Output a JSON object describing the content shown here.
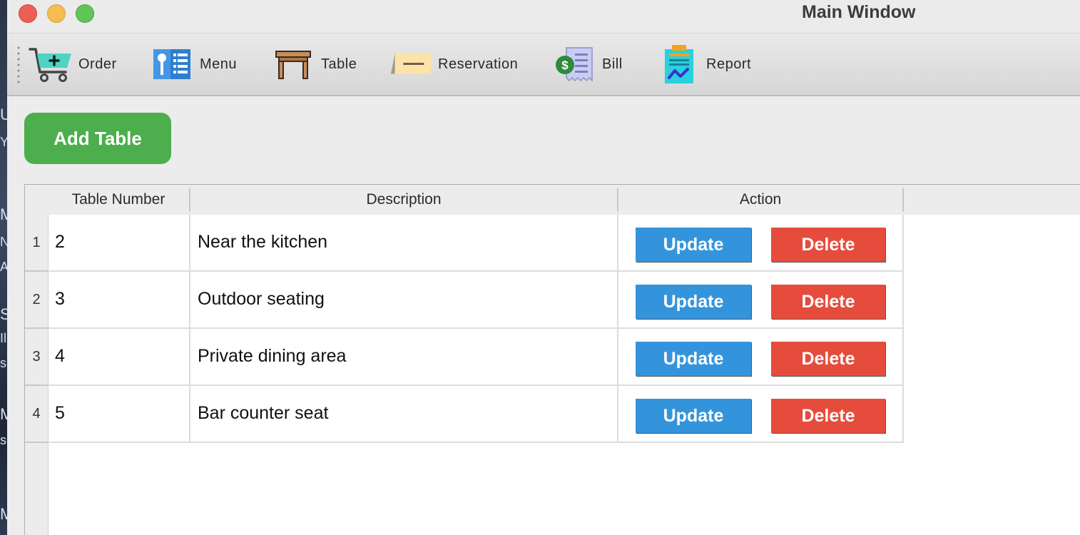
{
  "window": {
    "title": "Main Window"
  },
  "desktop_glimpse": [
    "U",
    "Y",
    "M",
    "N",
    "A",
    "S",
    "Il",
    "s",
    "M",
    "s",
    "M"
  ],
  "toolbar": {
    "items": [
      {
        "label": "Order",
        "icon": "shopping-cart-icon"
      },
      {
        "label": "Menu",
        "icon": "menu-list-icon"
      },
      {
        "label": "Table",
        "icon": "table-icon"
      },
      {
        "label": "Reservation",
        "icon": "reservation-sign-icon"
      },
      {
        "label": "Bill",
        "icon": "bill-receipt-icon"
      },
      {
        "label": "Report",
        "icon": "report-clipboard-icon"
      }
    ]
  },
  "add_table_label": "Add Table",
  "table": {
    "columns": [
      "Table Number",
      "Description",
      "Action"
    ],
    "rows": [
      {
        "index": "1",
        "number": "2",
        "description": "Near the kitchen"
      },
      {
        "index": "2",
        "number": "3",
        "description": "Outdoor seating"
      },
      {
        "index": "3",
        "number": "4",
        "description": "Private dining area"
      },
      {
        "index": "4",
        "number": "5",
        "description": "Bar counter seat"
      }
    ],
    "update_label": "Update",
    "delete_label": "Delete"
  },
  "colors": {
    "add_button": "#4cae4c",
    "update_button": "#3494db",
    "delete_button": "#e54c3c"
  }
}
